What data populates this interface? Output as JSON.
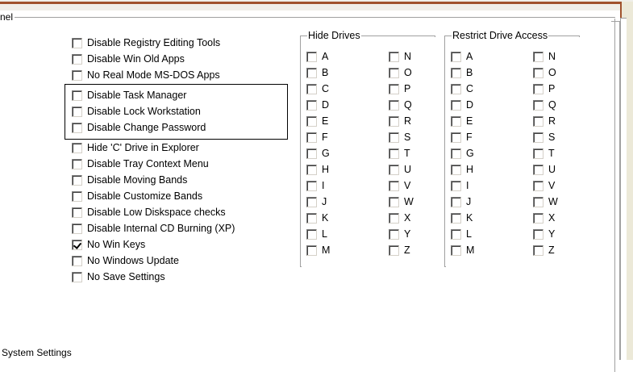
{
  "window": {
    "panel_legend": "nel"
  },
  "system_options": [
    {
      "label": "Disable Registry Editing Tools",
      "checked": false
    },
    {
      "label": "Disable Win Old Apps",
      "checked": false
    },
    {
      "label": "No Real Mode MS-DOS Apps",
      "checked": false
    },
    {
      "label": "Disable Task Manager",
      "checked": false
    },
    {
      "label": "Disable Lock Workstation",
      "checked": false
    },
    {
      "label": "Disable Change Password",
      "checked": false
    },
    {
      "label": "Hide 'C' Drive in Explorer",
      "checked": false
    },
    {
      "label": "Disable Tray Context Menu",
      "checked": false
    },
    {
      "label": "Disable Moving Bands",
      "checked": false
    },
    {
      "label": "Disable Customize Bands",
      "checked": false
    },
    {
      "label": "Disable Low Diskspace checks",
      "checked": false
    },
    {
      "label": "Disable Internal CD Burning (XP)",
      "checked": false
    },
    {
      "label": "No Win Keys",
      "checked": true
    },
    {
      "label": "No Windows Update",
      "checked": false
    },
    {
      "label": "No Save Settings",
      "checked": false
    }
  ],
  "hide_drives": {
    "title": "Hide Drives",
    "left": [
      "A",
      "B",
      "C",
      "D",
      "E",
      "F",
      "G",
      "H",
      "I",
      "J",
      "K",
      "L",
      "M"
    ],
    "right": [
      "N",
      "O",
      "P",
      "Q",
      "R",
      "S",
      "T",
      "U",
      "V",
      "W",
      "X",
      "Y",
      "Z"
    ]
  },
  "restrict_drives": {
    "title": "Restrict Drive Access",
    "left": [
      "A",
      "B",
      "C",
      "D",
      "E",
      "F",
      "G",
      "H",
      "I",
      "J",
      "K",
      "L",
      "M"
    ],
    "right": [
      "N",
      "O",
      "P",
      "Q",
      "R",
      "S",
      "T",
      "U",
      "V",
      "W",
      "X",
      "Y",
      "Z"
    ]
  },
  "footer": {
    "section_label": "System Settings"
  }
}
